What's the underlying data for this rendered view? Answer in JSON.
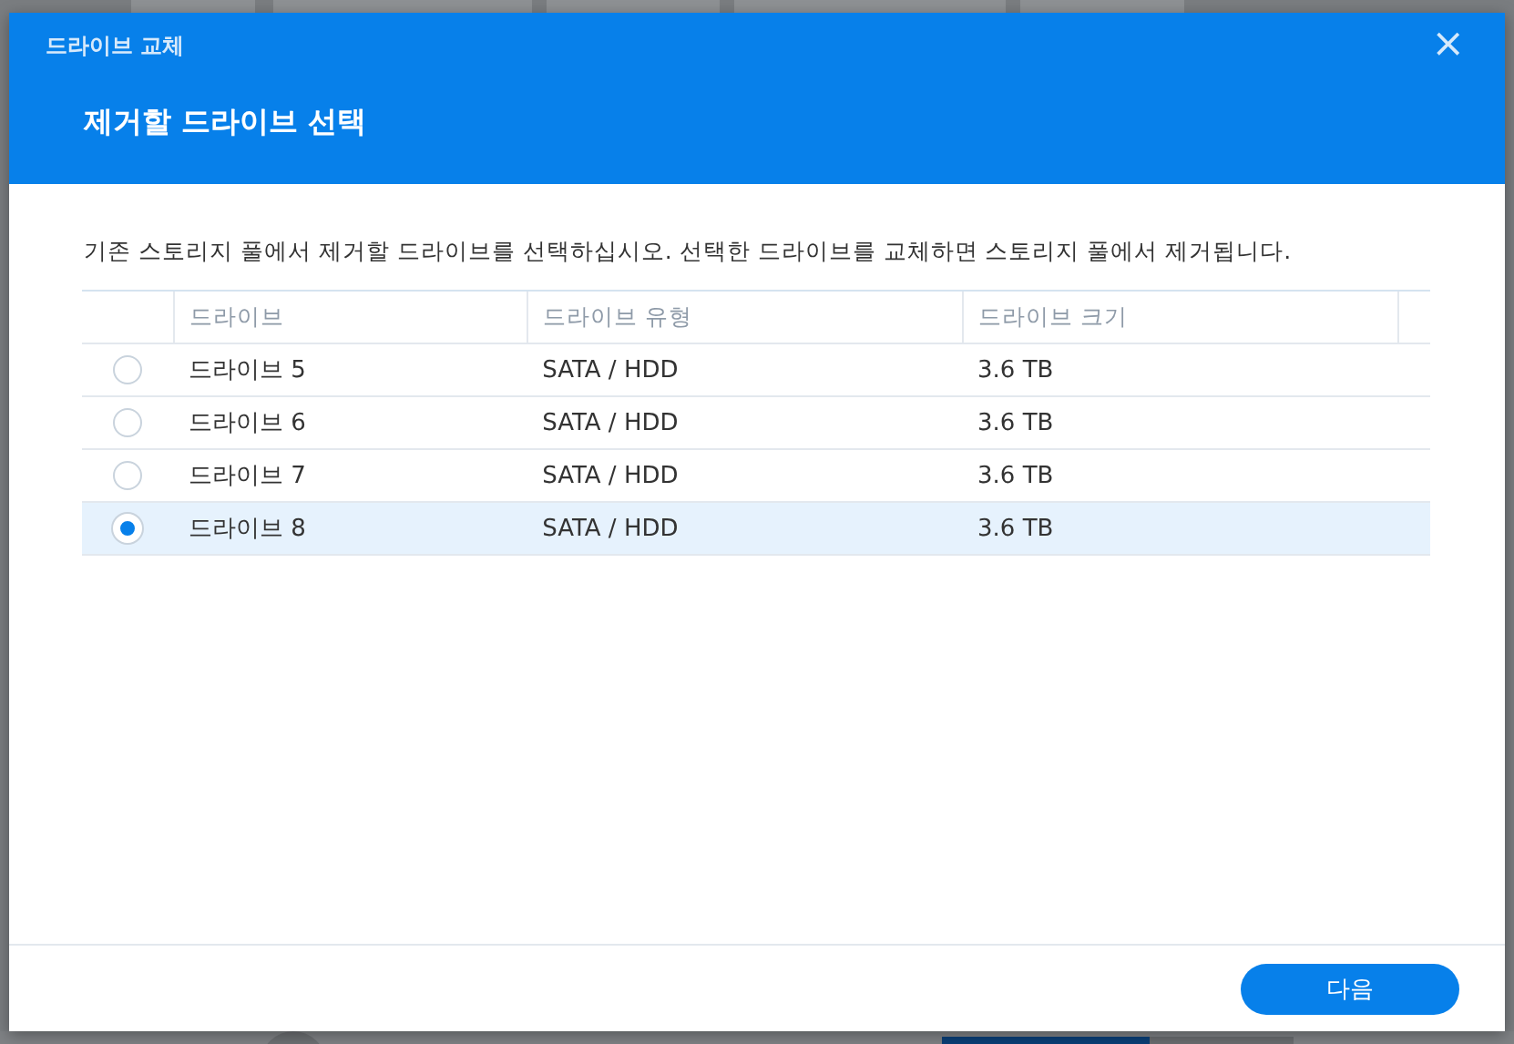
{
  "background": {
    "usage": {
      "level": 0.59
    }
  },
  "dialog": {
    "title": "드라이브 교체",
    "close": "×",
    "heading": "제거할 드라이브 선택",
    "description": "기존 스토리지 풀에서 제거할 드라이브를 선택하십시오. 선택한 드라이브를 교체하면 스토리지 풀에서 제거됩니다.",
    "table": {
      "columns": [
        "드라이브",
        "드라이브 유형",
        "드라이브 크기"
      ],
      "rows": [
        {
          "cells": [
            "드라이브 5",
            "SATA / HDD",
            "3.6 TB"
          ],
          "selected": false
        },
        {
          "cells": [
            "드라이브 6",
            "SATA / HDD",
            "3.6 TB"
          ],
          "selected": false
        },
        {
          "cells": [
            "드라이브 7",
            "SATA / HDD",
            "3.6 TB"
          ],
          "selected": false
        },
        {
          "cells": [
            "드라이브 8",
            "SATA / HDD",
            "3.6 TB"
          ],
          "selected": true
        }
      ]
    },
    "next_button": "다음"
  }
}
